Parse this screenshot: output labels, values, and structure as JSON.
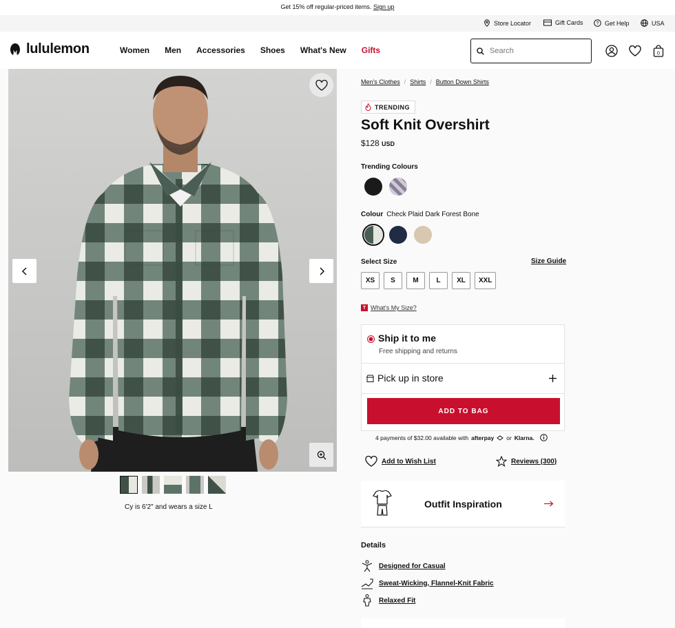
{
  "promo": {
    "text": "Get 15% off regular-priced items.",
    "link": "Sign up"
  },
  "utility": {
    "store_locator": "Store Locator",
    "gift_cards": "Gift Cards",
    "get_help": "Get Help",
    "region": "USA"
  },
  "nav": {
    "brand": "lululemon",
    "links": [
      "Women",
      "Men",
      "Accessories",
      "Shoes",
      "What's New",
      "Gifts"
    ],
    "search_placeholder": "Search",
    "bag_count": "0"
  },
  "gallery": {
    "caption": "Cy is 6'2\" and wears a size L",
    "thumb_count": 5
  },
  "breadcrumbs": [
    "Men's Clothes",
    "Shirts",
    "Button Down Shirts"
  ],
  "product": {
    "badge": "TRENDING",
    "title": "Soft Knit Overshirt",
    "price": "$128",
    "currency": "USD",
    "trending_colours_label": "Trending Colours",
    "colour_label": "Colour",
    "colour_value": "Check Plaid Dark Forest Bone",
    "select_size_label": "Select Size",
    "size_guide": "Size Guide",
    "sizes": [
      "XS",
      "S",
      "M",
      "L",
      "XL",
      "XXL"
    ],
    "whats_my_size": "What's My Size?"
  },
  "fulfillment": {
    "ship_title": "Ship it to me",
    "ship_sub": "Free shipping and returns",
    "pickup": "Pick up in store",
    "add_to_bag": "ADD TO BAG",
    "afterpay_text": "4 payments of $32.00 available with",
    "afterpay_brand": "afterpay",
    "or_text": "or",
    "klarna": "Klarna."
  },
  "actions": {
    "wish_list": "Add to Wish List",
    "reviews": "Reviews (300)"
  },
  "outfit": {
    "label": "Outfit Inspiration"
  },
  "details": {
    "heading": "Details",
    "items": [
      "Designed for Casual",
      "Sweat-Wicking, Flannel-Knit Fabric",
      "Relaxed Fit"
    ]
  },
  "colors": {
    "accent_red": "#c8102e",
    "swatch_black": "#1a1a1a",
    "swatch_plaid_purple": "#8a7f96",
    "swatch_plaid_forest": "#4a5e55",
    "swatch_navy": "#1f2c44",
    "swatch_bone": "#d8c8b0"
  }
}
